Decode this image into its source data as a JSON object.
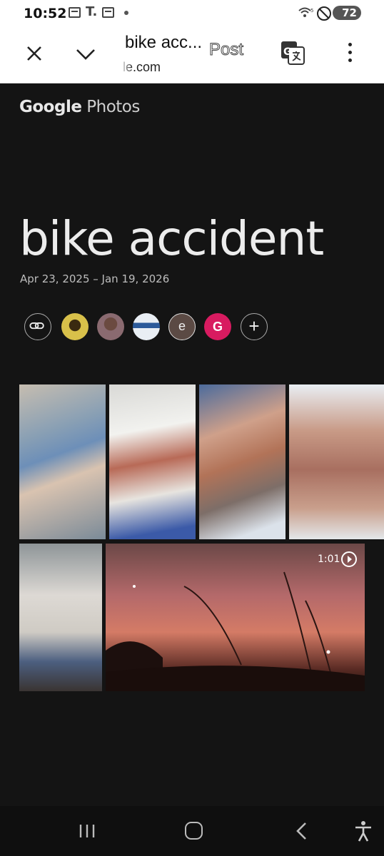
{
  "status_bar": {
    "time": "10:52",
    "t_icon": "T.",
    "battery": "72"
  },
  "browser": {
    "title": "bike acc...",
    "url": "le.com",
    "post_label": "Post",
    "icons": [
      "close-icon",
      "chevron-down-icon",
      "translate-icon",
      "more-vert-icon"
    ]
  },
  "album": {
    "brand_google": "Google",
    "brand_photos": "Photos",
    "title": "bike accident",
    "date_range": "Apr 23, 2025 – Jan 19, 2026",
    "avatar_e": "e",
    "avatar_g": "G",
    "add_label": "+",
    "video_duration": "1:01"
  },
  "colors": {
    "background": "#141414",
    "avatar_g": "#d81b60"
  }
}
